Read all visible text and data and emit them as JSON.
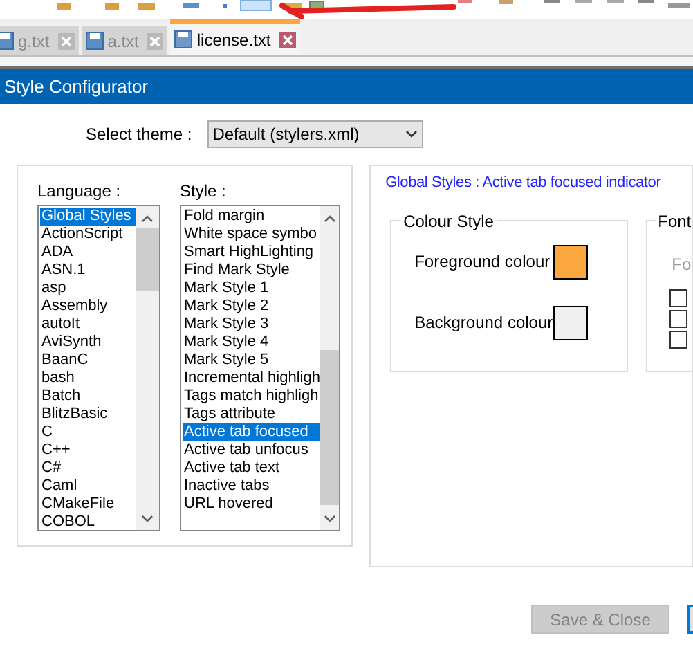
{
  "tabs": [
    {
      "label": "g.txt",
      "selected": false
    },
    {
      "label": "a.txt",
      "selected": false
    },
    {
      "label": "license.txt",
      "selected": true
    }
  ],
  "dialog": {
    "title": "Style Configurator"
  },
  "theme": {
    "label": "Select theme :",
    "value": "Default (stylers.xml)"
  },
  "languages": {
    "label": "Language :",
    "items": [
      {
        "name": "Global Styles",
        "selected": true
      },
      {
        "name": "ActionScript",
        "selected": false
      },
      {
        "name": "ADA",
        "selected": false
      },
      {
        "name": "ASN.1",
        "selected": false
      },
      {
        "name": "asp",
        "selected": false
      },
      {
        "name": "Assembly",
        "selected": false
      },
      {
        "name": "autoIt",
        "selected": false
      },
      {
        "name": "AviSynth",
        "selected": false
      },
      {
        "name": "BaanC",
        "selected": false
      },
      {
        "name": "bash",
        "selected": false
      },
      {
        "name": "Batch",
        "selected": false
      },
      {
        "name": "BlitzBasic",
        "selected": false
      },
      {
        "name": "C",
        "selected": false
      },
      {
        "name": "C++",
        "selected": false
      },
      {
        "name": "C#",
        "selected": false
      },
      {
        "name": "Caml",
        "selected": false
      },
      {
        "name": "CMakeFile",
        "selected": false
      },
      {
        "name": "COBOL",
        "selected": false
      }
    ]
  },
  "styles": {
    "label": "Style :",
    "items": [
      {
        "name": "Fold margin",
        "selected": false
      },
      {
        "name": "White space symbo",
        "selected": false
      },
      {
        "name": "Smart HighLighting",
        "selected": false
      },
      {
        "name": "Find Mark Style",
        "selected": false
      },
      {
        "name": "Mark Style 1",
        "selected": false
      },
      {
        "name": "Mark Style 2",
        "selected": false
      },
      {
        "name": "Mark Style 3",
        "selected": false
      },
      {
        "name": "Mark Style 4",
        "selected": false
      },
      {
        "name": "Mark Style 5",
        "selected": false
      },
      {
        "name": "Incremental highligh",
        "selected": false
      },
      {
        "name": "Tags match highligh",
        "selected": false
      },
      {
        "name": "Tags attribute",
        "selected": false
      },
      {
        "name": "Active tab focused",
        "selected": true
      },
      {
        "name": "Active tab unfocus",
        "selected": false
      },
      {
        "name": "Active tab text",
        "selected": false
      },
      {
        "name": "Inactive tabs",
        "selected": false
      },
      {
        "name": "URL hovered",
        "selected": false
      }
    ]
  },
  "header": "Global Styles : Active tab focused indicator",
  "colour_style": {
    "title": "Colour Style",
    "foreground": {
      "label": "Foreground colour",
      "color": "#f9a73e"
    },
    "background": {
      "label": "Background colour",
      "color": "#f0f0f0"
    }
  },
  "font": {
    "title": "Font",
    "name_label": "Fo",
    "checkboxes": [
      {
        "checked": false
      },
      {
        "checked": false
      },
      {
        "checked": false
      }
    ]
  },
  "save_button": {
    "label": "Save & Close",
    "disabled": true
  }
}
